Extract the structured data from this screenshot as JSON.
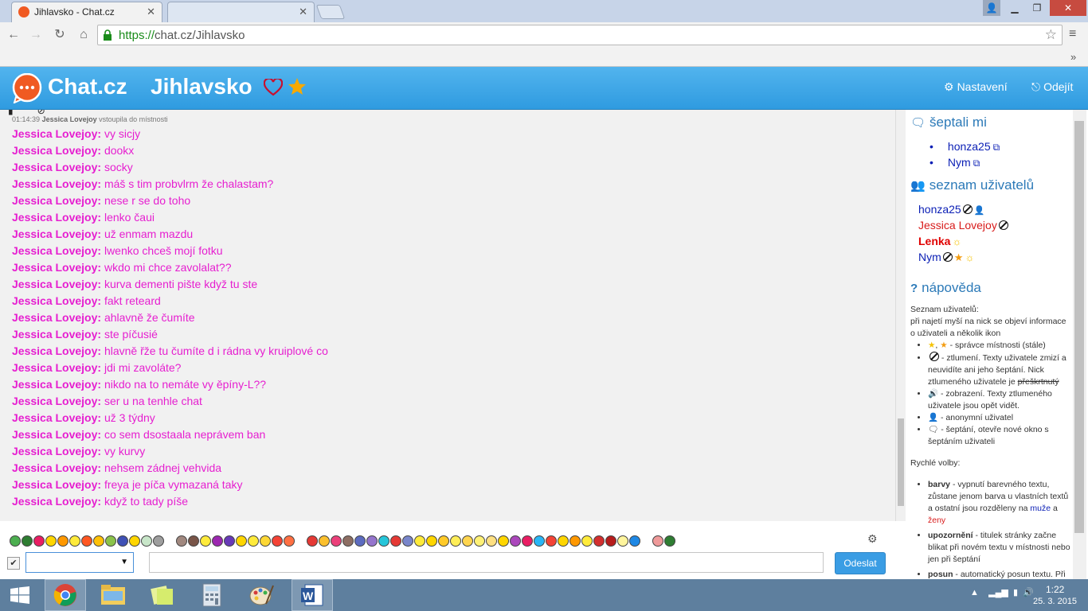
{
  "browser": {
    "tab_title": "Jihlavsko - Chat.cz",
    "tab_close": "✕",
    "tab2_close": "✕",
    "url_scheme": "https://",
    "url_rest": "chat.cz/Jihlavsko",
    "overflow": "»"
  },
  "header": {
    "logo_text": "Chat.cz",
    "room_title": "Jihlavsko",
    "settings_label": "Nastavení",
    "logout_label": "Odejít"
  },
  "chat": {
    "system_message": {
      "time": "01:14:39",
      "nick": "Jessica Lovejoy",
      "text": "vstoupila do místnosti"
    },
    "messages": [
      {
        "nick": "Jessica Lovejoy:",
        "text": "vy sicjy"
      },
      {
        "nick": "Jessica Lovejoy:",
        "text": "dookx"
      },
      {
        "nick": "Jessica Lovejoy:",
        "text": "socky"
      },
      {
        "nick": "Jessica Lovejoy:",
        "text": "máš s tim probvlrm že chalastam?"
      },
      {
        "nick": "Jessica Lovejoy:",
        "text": "nese r se do toho"
      },
      {
        "nick": "Jessica Lovejoy:",
        "text": "lenko čaui"
      },
      {
        "nick": "Jessica Lovejoy:",
        "text": "už enmam mazdu"
      },
      {
        "nick": "Jessica Lovejoy:",
        "text": "lwenko chceš mojí fotku"
      },
      {
        "nick": "Jessica Lovejoy:",
        "text": "wkdo mi chce zavolalat??"
      },
      {
        "nick": "Jessica Lovejoy:",
        "text": "kurva dementi pište když tu ste"
      },
      {
        "nick": "Jessica Lovejoy:",
        "text": "fakt reteard"
      },
      {
        "nick": "Jessica Lovejoy:",
        "text": "ahlavně že čumíte"
      },
      {
        "nick": "Jessica Lovejoy:",
        "text": "ste píčusié"
      },
      {
        "nick": "Jessica Lovejoy:",
        "text": "hlavně řže tu čumíte d i rádna vy kruiplové co"
      },
      {
        "nick": "Jessica Lovejoy:",
        "text": "jdi mi zavoláte?"
      },
      {
        "nick": "Jessica Lovejoy:",
        "text": "nikdo na to nemáte vy ěpíny-L??"
      },
      {
        "nick": "Jessica Lovejoy:",
        "text": "ser u na tenhle chat"
      },
      {
        "nick": "Jessica Lovejoy:",
        "text": "už 3 týdny"
      },
      {
        "nick": "Jessica Lovejoy:",
        "text": "co sem dsostaala neprávem ban"
      },
      {
        "nick": "Jessica Lovejoy:",
        "text": "vy kurvy"
      },
      {
        "nick": "Jessica Lovejoy:",
        "text": "nehsem zádnej vehvida"
      },
      {
        "nick": "Jessica Lovejoy:",
        "text": "freya je píča vymazaná taky"
      },
      {
        "nick": "Jessica Lovejoy:",
        "text": "když to tady píše"
      }
    ],
    "send_label": "Odeslat"
  },
  "sidebar": {
    "whispers_title": "šeptali mi",
    "whispers": [
      "honza25",
      "Nym"
    ],
    "users_title": "seznam uživatelů",
    "users": [
      {
        "name": "honza25",
        "color": "#0a1eb5"
      },
      {
        "name": "Jessica Lovejoy",
        "color": "#d81b1b"
      },
      {
        "name": "Lenka",
        "color": "#e00000"
      },
      {
        "name": "Nym",
        "color": "#0a1eb5"
      }
    ],
    "help_title": "nápověda",
    "help": {
      "intro1": "Seznam uživatelů:",
      "intro2": "při najetí myší na nick se objeví informace o uživateli a několik ikon",
      "item_admin": " - správce místnosti (stále)",
      "item_mute_a": " - ztlumení. Texty uživatele zmizí a neuvidíte ani jeho šeptání. Nick ztlumeného uživatele je ",
      "item_mute_strike": "přeškrtnutý",
      "item_show": " - zobrazení. Texty ztlumeného uživatele jsou opět vidět.",
      "item_anon": " - anonymní uživatel",
      "item_whisper": " - šeptání, otevře nové okno s šeptáním uživateli",
      "quick_title": "Rychlé volby:",
      "barvy_label": "barvy",
      "barvy_text": " - vypnutí barevného textu, zůstane jenom barva u vlastních textů a ostatní jsou rozděleny na ",
      "barvy_men": "muže",
      "barvy_and": " a ",
      "barvy_women": "ženy",
      "upoz_label": "upozornění",
      "upoz_text": " - titulek stránky začne blikat při novém textu v místnosti nebo jen při šeptání",
      "posun_label": "posun",
      "posun_text": " - automatický posun textu. Při odrolování nahoru se sám vypne"
    }
  },
  "taskbar": {
    "time": "1:22",
    "date": "25. 3. 2015"
  },
  "colors": {
    "header_blue": "#2f9be0",
    "nick_pink": "#e61fd0",
    "link_blue": "#2c7ab8",
    "taskbar": "#5e7f9e"
  },
  "icons": {
    "whisper": "comment-icon",
    "users": "users-icon",
    "help": "question-icon",
    "settings": "gear-icon",
    "logout": "sign-out-icon"
  }
}
